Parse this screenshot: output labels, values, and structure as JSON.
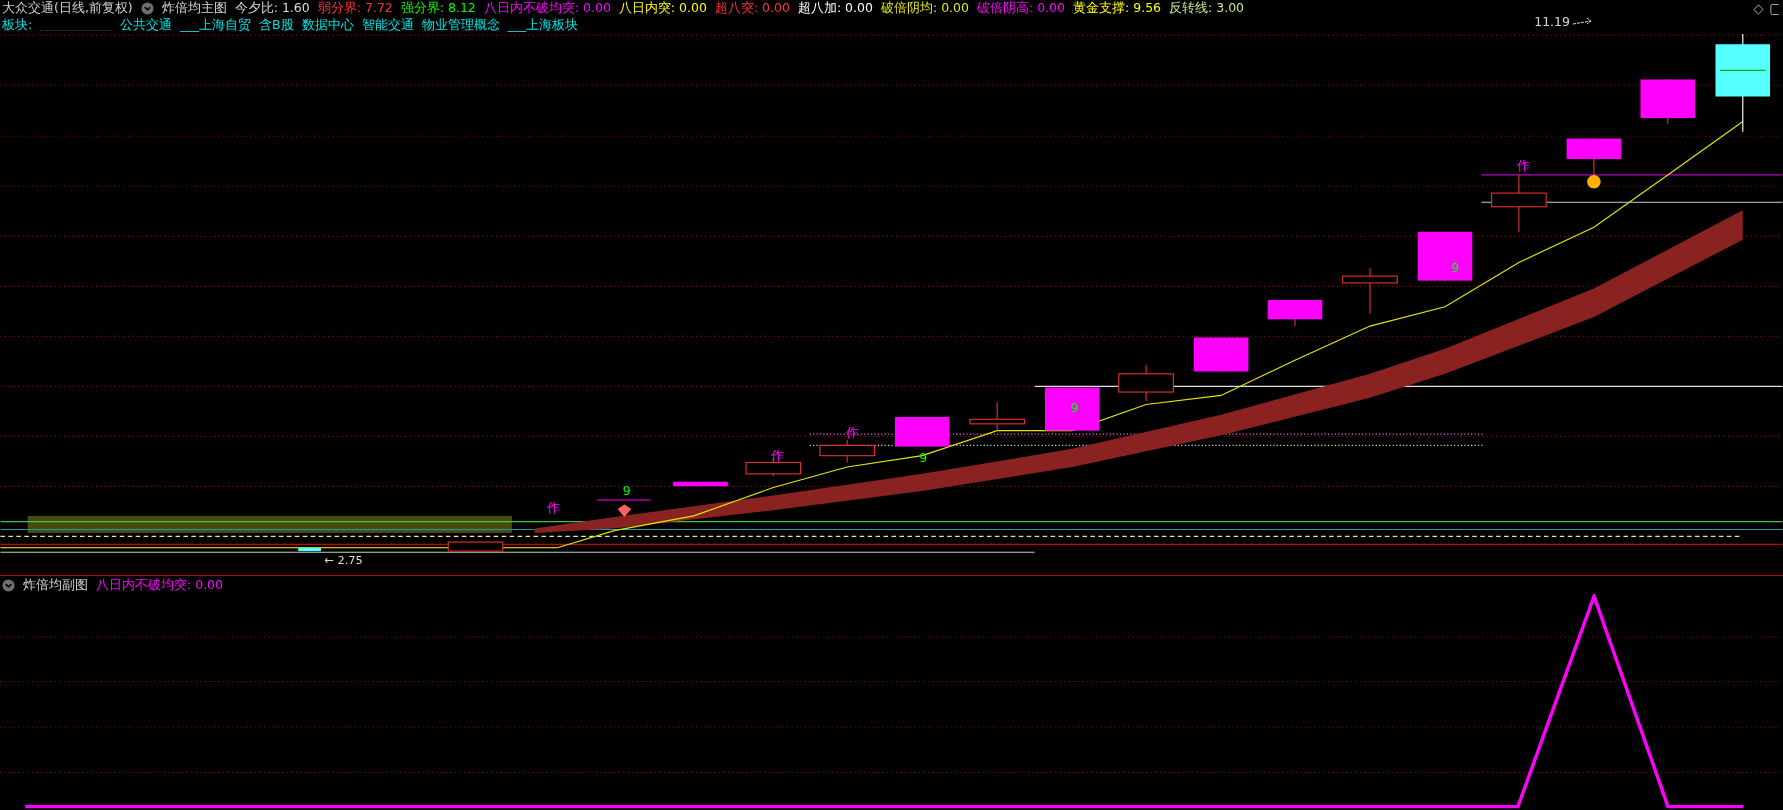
{
  "window": {
    "title": "大众交通(日线,前复权)"
  },
  "main_panel": {
    "name": "炸倍均主图",
    "indicators": [
      {
        "label": "今夕比:",
        "value": "1.60",
        "color": "#dcdcdc"
      },
      {
        "label": "弱分界:",
        "value": "7.72",
        "color": "#ff3232"
      },
      {
        "label": "强分界:",
        "value": "8.12",
        "color": "#00ff00"
      },
      {
        "label": "八日内不破均突:",
        "value": "0.00",
        "color": "#ff00ff"
      },
      {
        "label": "八日内突:",
        "value": "0.00",
        "color": "#ffff00"
      },
      {
        "label": "超八突:",
        "value": "0.00",
        "color": "#ff3232"
      },
      {
        "label": "超八加:",
        "value": "0.00",
        "color": "#ffffff"
      },
      {
        "label": "破倍阴均:",
        "value": "0.00",
        "color": "#e6e600"
      },
      {
        "label": "破倍阴高:",
        "value": "0.00",
        "color": "#ff00ff"
      },
      {
        "label": "黄金支撑:",
        "value": "9.56",
        "color": "#ffff00"
      },
      {
        "label": "反转线:",
        "value": "3.00",
        "color": "#c8e68c"
      }
    ],
    "sector_label": "板块:",
    "sectors": [
      "公共交通",
      "___上海自贸",
      "含B股",
      "数据中心",
      "智能交通",
      "物业管理概念",
      "___上海板块"
    ],
    "high_label": "11.19",
    "low_label": "← 2.75",
    "marks": [
      {
        "text": "作",
        "kind": "zha"
      },
      {
        "text": "作",
        "kind": "zha"
      },
      {
        "text": "作",
        "kind": "zha"
      },
      {
        "text": "作",
        "kind": "zha"
      },
      {
        "text": "9",
        "kind": "nine"
      },
      {
        "text": "9",
        "kind": "nine"
      },
      {
        "text": "9",
        "kind": "nine"
      },
      {
        "text": "9",
        "kind": "nine"
      }
    ]
  },
  "sub_panel": {
    "name": "炸倍均副图",
    "indicators": [
      {
        "label": "八日内不破均突:",
        "value": "0.00",
        "color": "#ff00ff"
      }
    ]
  }
}
